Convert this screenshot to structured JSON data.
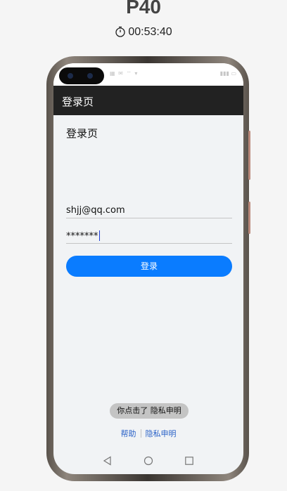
{
  "device": {
    "name": "P40",
    "timer": "00:53:40"
  },
  "app": {
    "appbar_title": "登录页",
    "page_heading": "登录页",
    "email_value": "shjj@qq.com",
    "password_value": "*******",
    "login_button": "登录",
    "toast": "你点击了 隐私申明",
    "footer": {
      "help": "帮助",
      "privacy": "隐私申明"
    }
  },
  "icons": [
    "stopwatch-icon",
    "back-nav-icon",
    "home-nav-icon",
    "recents-nav-icon"
  ],
  "colors": {
    "appbar": "#222222",
    "accent": "#0a7cff",
    "link": "#2a62c8",
    "screen_bg": "#f1f3f5"
  }
}
